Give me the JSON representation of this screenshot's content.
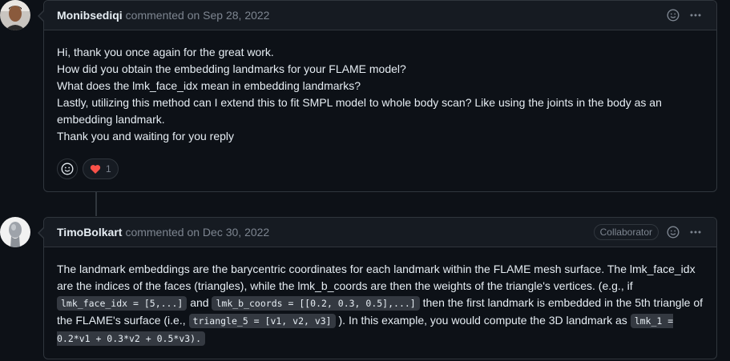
{
  "comments": [
    {
      "author": "Monibsediqi",
      "meta": "commented on Sep 28, 2022",
      "lines": [
        "Hi, thank you once again for the great work.",
        "How did you obtain the embedding landmarks for your FLAME model?",
        "What does the lmk_face_idx mean in embedding landmarks?",
        "Lastly, utilizing this method can I extend this to fit SMPL model to whole body scan? Like using the joints in the body as an embedding landmark.",
        "Thank you and waiting for you reply"
      ],
      "reactions": [
        {
          "icon": "heart-icon",
          "count": "1"
        }
      ]
    },
    {
      "author": "TimoBolkart",
      "meta": "commented on Dec 30, 2022",
      "badge": "Collaborator",
      "body": {
        "t1": "The landmark embeddings are the barycentric coordinates for each landmark within the FLAME mesh surface. The lmk_face_idx are the indices of the faces (triangles), while the lmk_b_coords are then the weights of the triangle's vertices. (e.g., if ",
        "c1": "lmk_face_idx = [5,...]",
        "t2": " and ",
        "c2": "lmk_b_coords = [[0.2, 0.3, 0.5],...]",
        "t3": " then the first landmark is embedded in the 5th triangle of the FLAME's surface (i.e., ",
        "c3": "triangle_5 = [v1, v2, v3]",
        "t4": " ). In this example, you would compute the 3D landmark as ",
        "c4": "lmk_1 = 0.2*v1 + 0.3*v2 + 0.5*v3)."
      }
    }
  ],
  "colors": {
    "accent_heart": "#f85149",
    "border": "#30363d",
    "header_bg": "#161b22"
  }
}
